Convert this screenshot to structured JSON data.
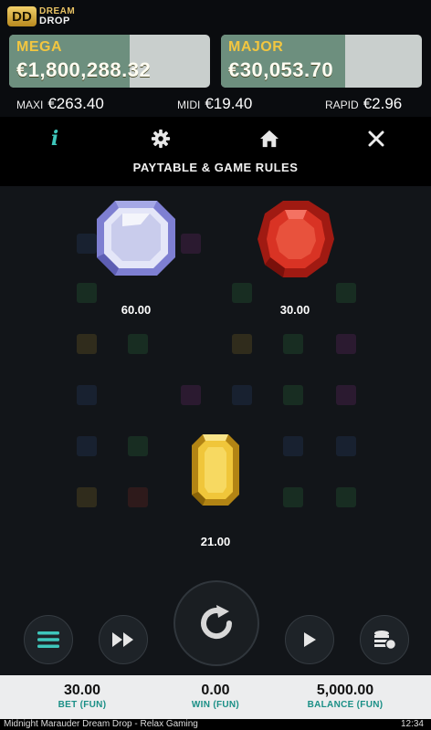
{
  "header": {
    "logo": {
      "badge": "DD",
      "line1": "DREAM",
      "line2": "DROP"
    },
    "jackpots": {
      "mega": {
        "label": "MEGA",
        "amount": "€1,800,288.32",
        "fill_fraction": 0.6
      },
      "major": {
        "label": "MAJOR",
        "amount": "€30,053.70",
        "fill_fraction": 0.62
      }
    },
    "minor": {
      "maxi": {
        "label": "MAXI",
        "amount": "€263.40"
      },
      "midi": {
        "label": "MIDI",
        "amount": "€19.40"
      },
      "rapid": {
        "label": "RAPID",
        "amount": "€2.96"
      }
    },
    "colors": {
      "jackpot_name": "#f2c640",
      "accent": "#3ec6bb"
    }
  },
  "panel": {
    "title": "PAYTABLE & GAME RULES",
    "tabs": [
      {
        "icon": "info-icon",
        "active": true
      },
      {
        "icon": "gear-icon"
      },
      {
        "icon": "home-icon"
      },
      {
        "icon": "close-icon"
      }
    ]
  },
  "paytable": {
    "items": [
      {
        "symbol": "diamond-gem",
        "value": "60.00"
      },
      {
        "symbol": "ruby-gem",
        "value": "30.00"
      },
      {
        "symbol": "topaz-gem",
        "value": "21.00"
      }
    ]
  },
  "controls": [
    "menu-icon",
    "fast-forward-icon",
    "spin-icon",
    "autoplay-icon",
    "coins-icon"
  ],
  "footer": {
    "bet": {
      "value": "30.00",
      "label": "BET (FUN)"
    },
    "win": {
      "value": "0.00",
      "label": "WIN (FUN)"
    },
    "balance": {
      "value": "5,000.00",
      "label": "BALANCE (FUN)"
    }
  },
  "statusbar": {
    "game_title": "Midnight Marauder Dream Drop - Relax Gaming",
    "time": "12:34"
  }
}
